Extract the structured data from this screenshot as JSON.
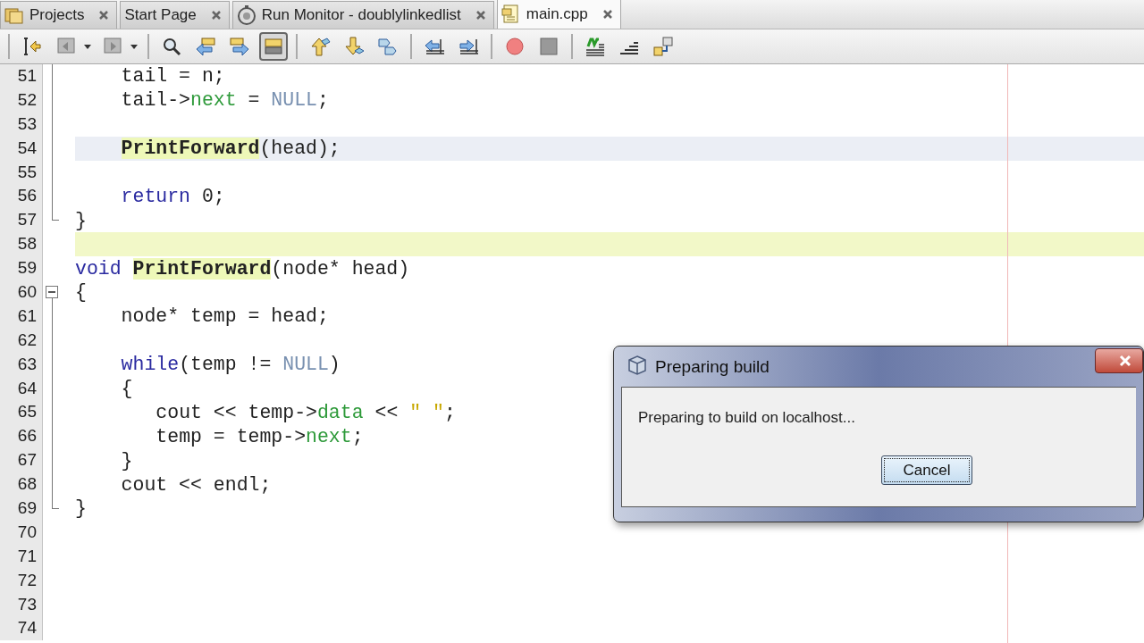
{
  "tabs": [
    {
      "label": "Projects",
      "kind": "folder",
      "selected": false
    },
    {
      "label": "Start Page",
      "kind": "plain",
      "selected": false
    },
    {
      "label": "Run Monitor - doublylinkedlist",
      "kind": "monitor",
      "selected": false
    },
    {
      "label": "main.cpp",
      "kind": "file",
      "selected": true
    }
  ],
  "toolbar": [
    {
      "kind": "separator"
    },
    {
      "kind": "button",
      "selected": false
    },
    {
      "kind": "dropdown",
      "selected": false
    },
    {
      "kind": "dropdown",
      "selected": false
    },
    {
      "kind": "separator"
    },
    {
      "kind": "button",
      "selected": false
    },
    {
      "kind": "button",
      "selected": false
    },
    {
      "kind": "button",
      "selected": false
    },
    {
      "kind": "button",
      "selected": true
    },
    {
      "kind": "separator"
    },
    {
      "kind": "button",
      "selected": false
    },
    {
      "kind": "button",
      "selected": false
    },
    {
      "kind": "button",
      "selected": false
    },
    {
      "kind": "separator"
    },
    {
      "kind": "button",
      "selected": false
    },
    {
      "kind": "button",
      "selected": false
    },
    {
      "kind": "separator"
    },
    {
      "kind": "button",
      "selected": false
    },
    {
      "kind": "button",
      "selected": false
    },
    {
      "kind": "separator"
    },
    {
      "kind": "button",
      "selected": false
    },
    {
      "kind": "button",
      "selected": false
    },
    {
      "kind": "button",
      "selected": false
    }
  ],
  "editor": {
    "lines": [
      {
        "number": "51",
        "fold_line": true,
        "fold_end": false,
        "collapsible": false,
        "current": false,
        "marked": false,
        "tokens": [
          {
            "kind": "plain",
            "text": "    tail = n;"
          }
        ]
      },
      {
        "number": "52",
        "fold_line": true,
        "fold_end": false,
        "collapsible": false,
        "current": false,
        "marked": false,
        "tokens": [
          {
            "kind": "plain",
            "text": "    tail->"
          },
          {
            "kind": "field",
            "text": "next"
          },
          {
            "kind": "plain",
            "text": " = "
          },
          {
            "kind": "constant",
            "text": "NULL"
          },
          {
            "kind": "plain",
            "text": ";"
          }
        ]
      },
      {
        "number": "53",
        "fold_line": true,
        "fold_end": false,
        "collapsible": false,
        "current": false,
        "marked": false
      },
      {
        "number": "54",
        "fold_line": true,
        "fold_end": false,
        "collapsible": false,
        "current": true,
        "marked": false,
        "tokens": [
          {
            "kind": "function",
            "text": "    PrintForward",
            "marked": true
          },
          {
            "kind": "plain",
            "text": "(head);"
          }
        ]
      },
      {
        "number": "55",
        "fold_line": true,
        "fold_end": false,
        "collapsible": false,
        "current": false,
        "marked": false
      },
      {
        "number": "56",
        "fold_line": true,
        "fold_end": false,
        "collapsible": false,
        "current": false,
        "marked": false,
        "tokens": [
          {
            "kind": "keyword",
            "text": "    return"
          },
          {
            "kind": "plain",
            "text": " 0;"
          }
        ]
      },
      {
        "number": "57",
        "fold_line": false,
        "fold_end": true,
        "collapsible": false,
        "current": false,
        "marked": false,
        "tokens": [
          {
            "kind": "plain",
            "text": "}"
          }
        ]
      },
      {
        "number": "58",
        "fold_line": false,
        "fold_end": false,
        "collapsible": false,
        "current": false,
        "marked": true
      },
      {
        "number": "59",
        "fold_line": false,
        "fold_end": false,
        "collapsible": false,
        "current": false,
        "marked": false,
        "tokens": [
          {
            "kind": "keyword",
            "text": "void"
          },
          {
            "kind": "function",
            "text": " PrintForward",
            "marked": true
          },
          {
            "kind": "plain",
            "text": "(node* head)"
          }
        ]
      },
      {
        "number": "60",
        "fold_line": false,
        "fold_end": false,
        "collapsible": true,
        "current": false,
        "marked": false,
        "tokens": [
          {
            "kind": "plain",
            "text": "{"
          }
        ]
      },
      {
        "number": "61",
        "fold_line": true,
        "fold_end": false,
        "collapsible": false,
        "current": false,
        "marked": false,
        "tokens": [
          {
            "kind": "plain",
            "text": "    node* temp = head;"
          }
        ]
      },
      {
        "number": "62",
        "fold_line": true,
        "fold_end": false,
        "collapsible": false,
        "current": false,
        "marked": false
      },
      {
        "number": "63",
        "fold_line": true,
        "fold_end": false,
        "collapsible": false,
        "current": false,
        "marked": false,
        "tokens": [
          {
            "kind": "keyword",
            "text": "    while"
          },
          {
            "kind": "plain",
            "text": "(temp != "
          },
          {
            "kind": "constant",
            "text": "NULL"
          },
          {
            "kind": "plain",
            "text": ")"
          }
        ]
      },
      {
        "number": "64",
        "fold_line": true,
        "fold_end": false,
        "collapsible": false,
        "current": false,
        "marked": false,
        "tokens": [
          {
            "kind": "plain",
            "text": "    {"
          }
        ]
      },
      {
        "number": "65",
        "fold_line": true,
        "fold_end": false,
        "collapsible": false,
        "current": false,
        "marked": false,
        "tokens": [
          {
            "kind": "plain",
            "text": "       cout << temp->"
          },
          {
            "kind": "field",
            "text": "data"
          },
          {
            "kind": "plain",
            "text": " << "
          },
          {
            "kind": "string",
            "text": "\" \""
          },
          {
            "kind": "plain",
            "text": ";"
          }
        ]
      },
      {
        "number": "66",
        "fold_line": true,
        "fold_end": false,
        "collapsible": false,
        "current": false,
        "marked": false,
        "tokens": [
          {
            "kind": "plain",
            "text": "       temp = temp->"
          },
          {
            "kind": "field",
            "text": "next"
          },
          {
            "kind": "plain",
            "text": ";"
          }
        ]
      },
      {
        "number": "67",
        "fold_line": true,
        "fold_end": false,
        "collapsible": false,
        "current": false,
        "marked": false,
        "tokens": [
          {
            "kind": "plain",
            "text": "    }"
          }
        ]
      },
      {
        "number": "68",
        "fold_line": true,
        "fold_end": false,
        "collapsible": false,
        "current": false,
        "marked": false,
        "tokens": [
          {
            "kind": "plain",
            "text": "    cout << endl;"
          }
        ]
      },
      {
        "number": "69",
        "fold_line": false,
        "fold_end": true,
        "collapsible": false,
        "current": false,
        "marked": false,
        "tokens": [
          {
            "kind": "plain",
            "text": "}"
          }
        ]
      },
      {
        "number": "70",
        "fold_line": false,
        "fold_end": false,
        "collapsible": false,
        "current": false,
        "marked": false
      },
      {
        "number": "71",
        "fold_line": false,
        "fold_end": false,
        "collapsible": false,
        "current": false,
        "marked": false
      },
      {
        "number": "72",
        "fold_line": false,
        "fold_end": false,
        "collapsible": false,
        "current": false,
        "marked": false
      },
      {
        "number": "73",
        "fold_line": false,
        "fold_end": false,
        "collapsible": false,
        "current": false,
        "marked": false
      },
      {
        "number": "74",
        "fold_line": false,
        "fold_end": false,
        "collapsible": false,
        "current": false,
        "marked": false
      }
    ]
  },
  "dialog": {
    "title": "Preparing build",
    "message": "Preparing to build on localhost...",
    "buttons": [
      {
        "label": "Cancel",
        "focused": true
      }
    ]
  }
}
